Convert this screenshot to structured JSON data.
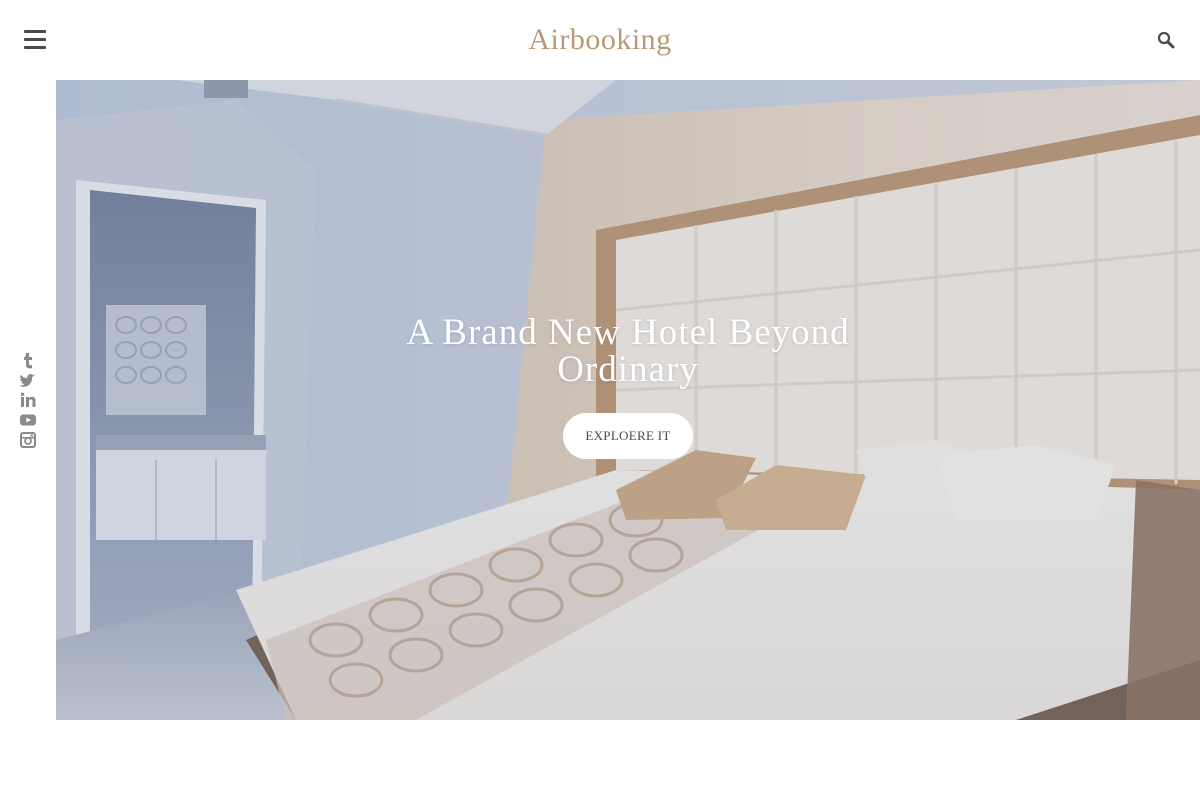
{
  "header": {
    "logo_text": "Airbooking",
    "menu_icon": "hamburger-menu-icon",
    "search_icon": "search-icon"
  },
  "social": {
    "items": [
      {
        "name": "tumblr-icon"
      },
      {
        "name": "twitter-icon"
      },
      {
        "name": "linkedin-icon"
      },
      {
        "name": "youtube-icon"
      },
      {
        "name": "instagram-icon"
      }
    ]
  },
  "hero": {
    "title": "A Brand New Hotel Beyond Ordinary",
    "button_label": "EXPLOERE IT"
  },
  "colors": {
    "brand": "#b89a78",
    "icon_gray": "#4a4a4a",
    "social_gray": "#8a8a8a",
    "hero_overlay": "#8a9ab8"
  }
}
